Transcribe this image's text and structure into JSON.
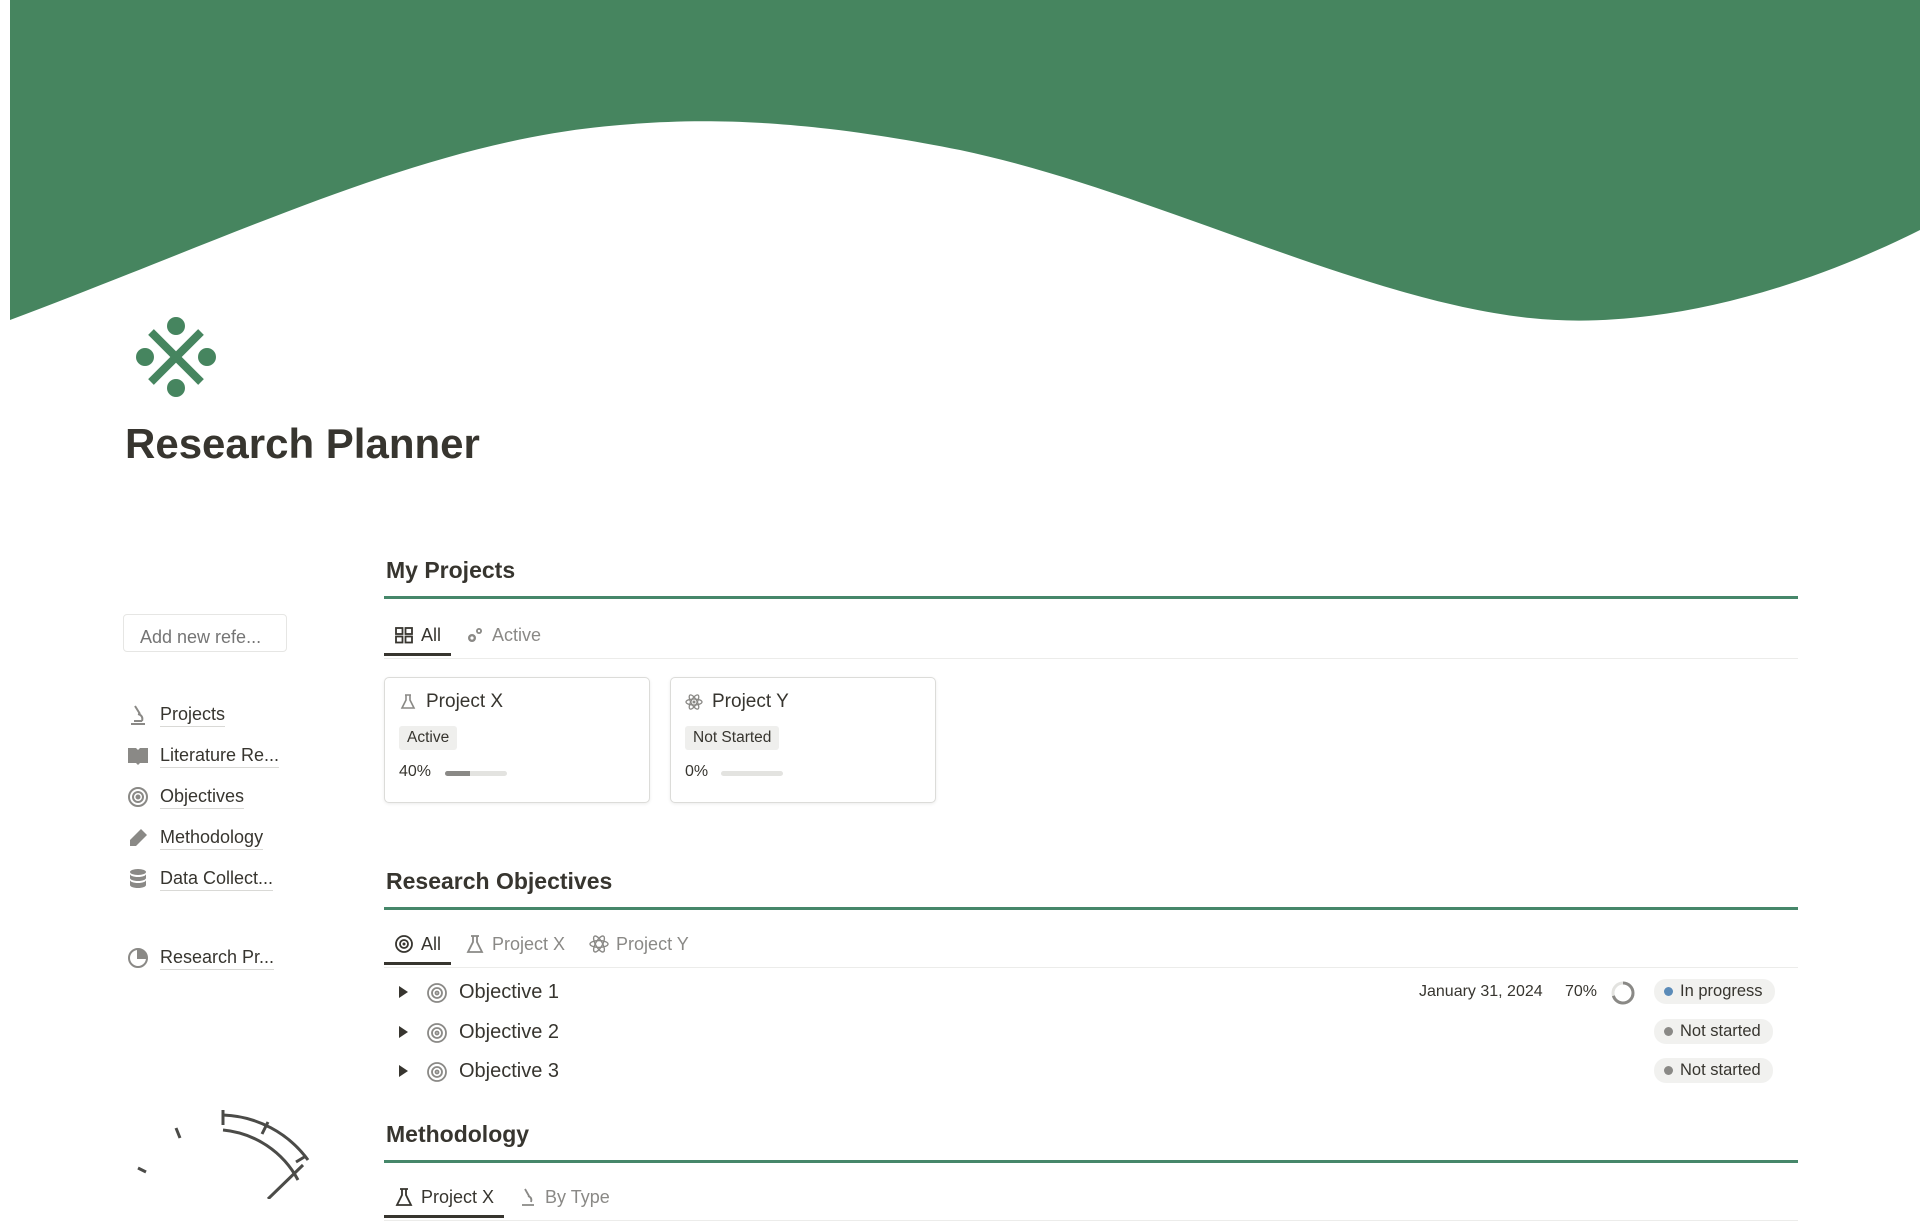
{
  "page": {
    "title": "Research Planner",
    "icon": "cross-dots-logo-icon",
    "accent_color": "#46876a"
  },
  "sidebar": {
    "search_placeholder": "Add new refe...",
    "items": [
      {
        "label": "Projects",
        "icon": "microscope-icon"
      },
      {
        "label": "Literature Re...",
        "icon": "book-icon"
      },
      {
        "label": "Objectives",
        "icon": "target-icon"
      },
      {
        "label": "Methodology",
        "icon": "pencil-icon"
      },
      {
        "label": "Data Collect...",
        "icon": "database-icon"
      }
    ],
    "secondary_item": {
      "label": "Research Pr...",
      "icon": "pie-chart-icon"
    }
  },
  "projects_section": {
    "heading": "My Projects",
    "tabs": [
      {
        "label": "All",
        "icon": "grid-icon",
        "active": true
      },
      {
        "label": "Active",
        "icon": "gears-icon",
        "active": false
      }
    ],
    "cards": [
      {
        "title": "Project X",
        "icon": "flask-icon",
        "status": "Active",
        "progress_label": "40%",
        "progress": 0.4
      },
      {
        "title": "Project Y",
        "icon": "atom-icon",
        "status": "Not Started",
        "progress_label": "0%",
        "progress": 0.0
      }
    ]
  },
  "objectives_section": {
    "heading": "Research Objectives",
    "tabs": [
      {
        "label": "All",
        "icon": "target-icon",
        "active": true
      },
      {
        "label": "Project X",
        "icon": "flask-icon",
        "active": false
      },
      {
        "label": "Project Y",
        "icon": "atom-icon",
        "active": false
      }
    ],
    "rows": [
      {
        "name": "Objective 1",
        "date": "January 31, 2024",
        "percent": "70%",
        "progress": 0.7,
        "status": "In progress",
        "status_color": "#5b8bb8"
      },
      {
        "name": "Objective 2",
        "date": "",
        "percent": "",
        "status": "Not started",
        "status_color": "#8a8986"
      },
      {
        "name": "Objective 3",
        "date": "",
        "percent": "",
        "status": "Not started",
        "status_color": "#8a8986"
      }
    ]
  },
  "methodology_section": {
    "heading": "Methodology",
    "tabs": [
      {
        "label": "Project X",
        "icon": "flask-icon",
        "active": true
      },
      {
        "label": "By Type",
        "icon": "microscope-icon",
        "active": false
      }
    ]
  }
}
